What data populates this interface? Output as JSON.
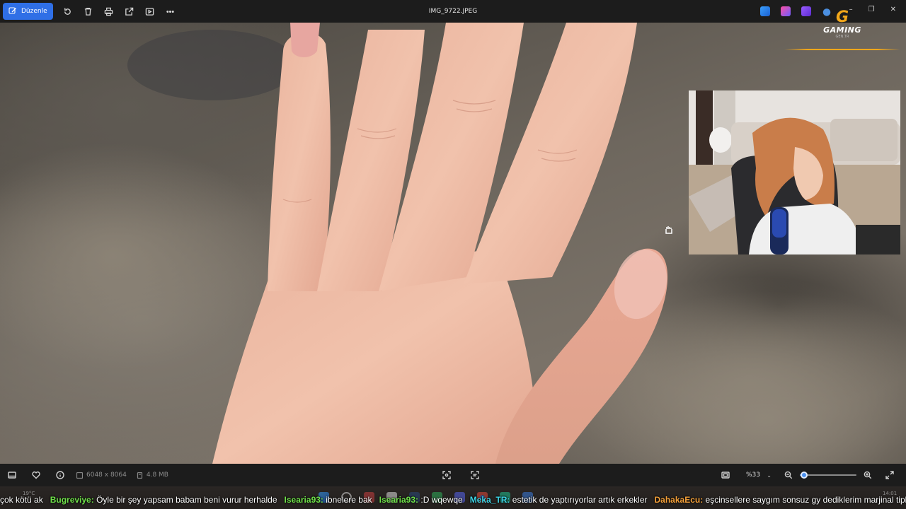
{
  "toolbar": {
    "edit_label": "Düzenle",
    "icons": [
      "rotate-icon",
      "delete-icon",
      "print-icon",
      "share-icon",
      "slideshow-icon",
      "more-icon"
    ]
  },
  "file": {
    "title": "IMG_9722.JPEG"
  },
  "logo": {
    "brand": "GAMING",
    "sub": "GEN.TR"
  },
  "bottom": {
    "dimensions": "6048 x 8064",
    "size": "4.8 MB",
    "zoom_label": "%33",
    "zoom_level": 0.08
  },
  "taskbar": {
    "weather": "19°C",
    "clock": "14:01"
  },
  "chat": {
    "colors": {
      "green": "#6fe04a",
      "cyan": "#3fd6e8",
      "orange": "#f5a13a"
    },
    "messages": [
      {
        "user": "",
        "text": "çok kötü ak",
        "color": "green"
      },
      {
        "user": "Bugreviye:",
        "text": "Öyle bir şey yapsam babam beni vurur herhalde",
        "color": "green"
      },
      {
        "user": "Isearia93:",
        "text": "ibnelere bak",
        "color": "green"
      },
      {
        "user": "Isearia93:",
        "text": ":D wqewqe",
        "color": "green"
      },
      {
        "user": "Meka_TR:",
        "text": "estetik de yaptırıyorlar artık erkekler",
        "color": "cyan"
      },
      {
        "user": "DahakaEcu:",
        "text": "eşcinsellere saygım sonsuz gy dediklerim marjinal tipler",
        "color": "orange"
      }
    ]
  },
  "accent": "#2f6fe6"
}
